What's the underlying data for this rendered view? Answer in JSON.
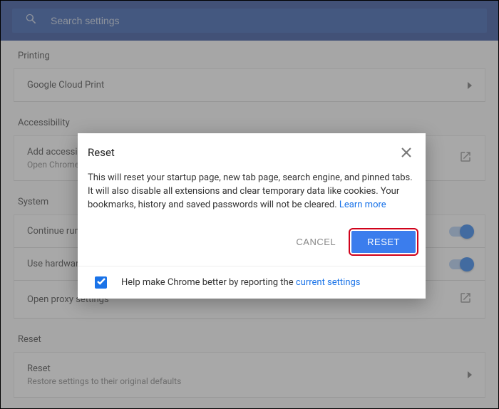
{
  "search": {
    "placeholder": "Search settings"
  },
  "sections": {
    "printing": {
      "title": "Printing",
      "item_label": "Google Cloud Print"
    },
    "accessibility": {
      "title": "Accessibility",
      "item_label": "Add accessibility features",
      "item_sub": "Open Chrome Web Store"
    },
    "system": {
      "title": "System",
      "rows": [
        {
          "label": "Continue running background apps when Google Chrome is closed"
        },
        {
          "label": "Use hardware acceleration when available"
        },
        {
          "label": "Open proxy settings"
        }
      ]
    },
    "reset": {
      "title": "Reset",
      "item_label": "Reset",
      "item_sub": "Restore settings to their original defaults"
    }
  },
  "dialog": {
    "title": "Reset",
    "body_prefix": "This will reset your startup page, new tab page, search engine, and pinned tabs. It will also disable all extensions and clear temporary data like cookies. Your bookmarks, history and saved passwords will not be cleared. ",
    "learn_more": "Learn more",
    "cancel_label": "CANCEL",
    "confirm_label": "RESET",
    "footer_prefix": "Help make Chrome better by reporting the ",
    "footer_link": "current settings"
  }
}
